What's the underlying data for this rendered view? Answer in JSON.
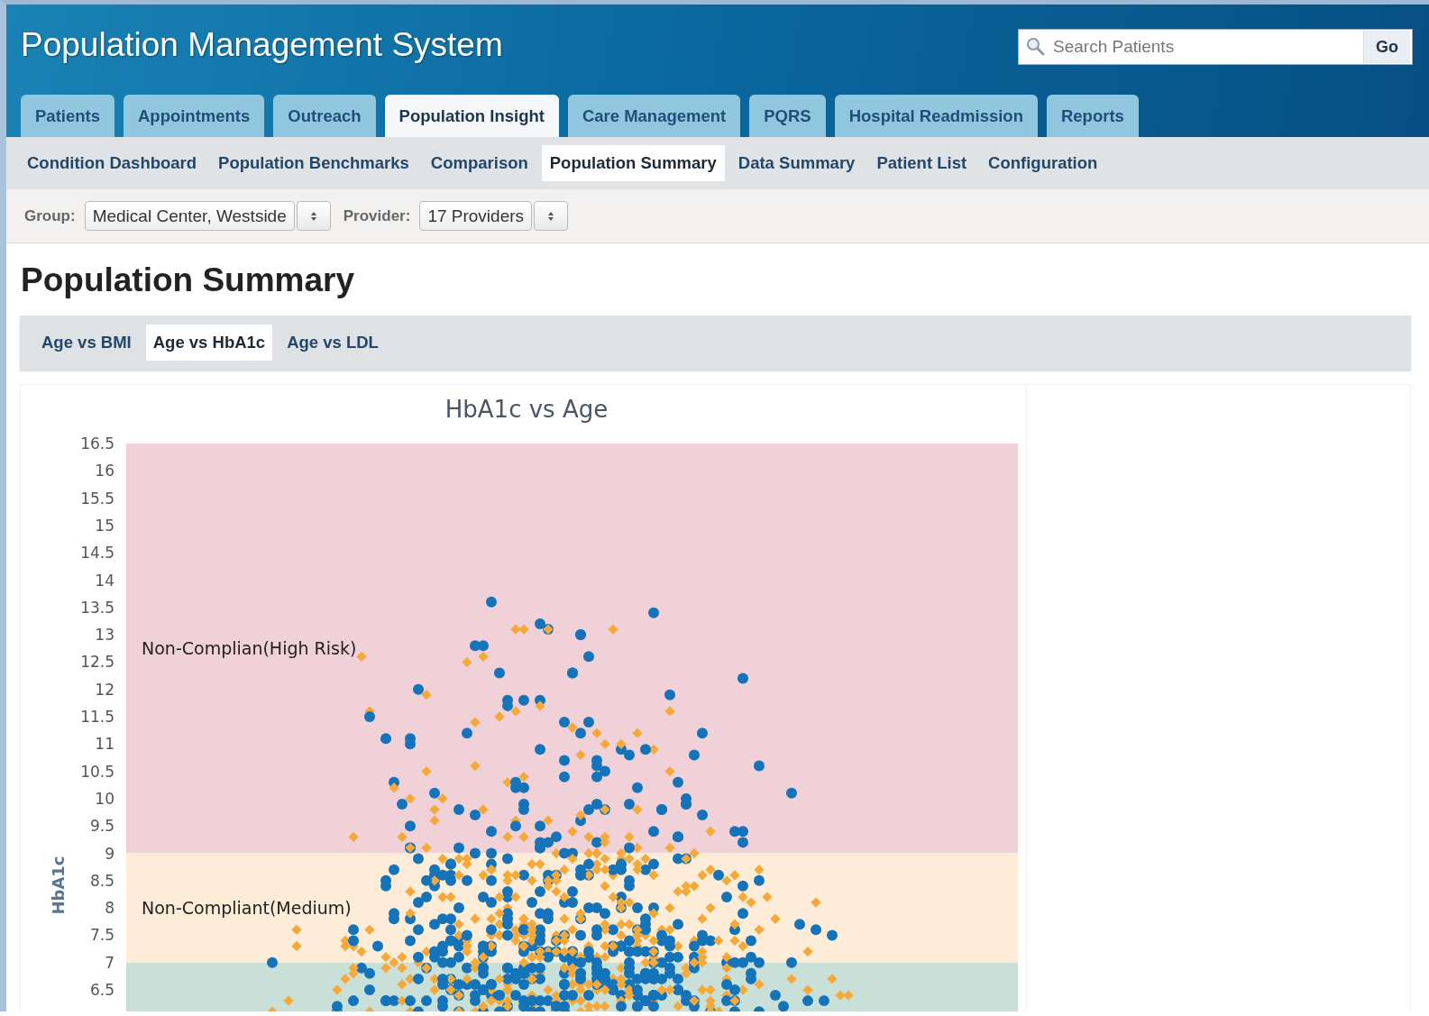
{
  "app": {
    "title": "Population Management System"
  },
  "search": {
    "placeholder": "Search Patients",
    "button": "Go"
  },
  "tabs": [
    {
      "label": "Patients",
      "selected": false
    },
    {
      "label": "Appointments",
      "selected": false
    },
    {
      "label": "Outreach",
      "selected": false
    },
    {
      "label": "Population Insight",
      "selected": true
    },
    {
      "label": "Care Management",
      "selected": false
    },
    {
      "label": "PQRS",
      "selected": false
    },
    {
      "label": "Hospital Readmission",
      "selected": false
    },
    {
      "label": "Reports",
      "selected": false
    }
  ],
  "subnav": [
    {
      "label": "Condition Dashboard",
      "selected": false
    },
    {
      "label": "Population Benchmarks",
      "selected": false
    },
    {
      "label": "Comparison",
      "selected": false
    },
    {
      "label": "Population Summary",
      "selected": true
    },
    {
      "label": "Data Summary",
      "selected": false
    },
    {
      "label": "Patient List",
      "selected": false
    },
    {
      "label": "Configuration",
      "selected": false
    }
  ],
  "filters": [
    {
      "label": "Group:",
      "value": "Medical Center, Westside"
    },
    {
      "label": "Provider:",
      "value": "17 Providers"
    }
  ],
  "heading": "Population Summary",
  "chart_tabs": [
    {
      "label": "Age vs BMI",
      "selected": false
    },
    {
      "label": "Age vs HbA1c",
      "selected": true
    },
    {
      "label": "Age vs LDL",
      "selected": false
    }
  ],
  "chart": {
    "title": "HbA1c vs Age",
    "ylabel": "HbA1c",
    "yticks": [
      "16.5",
      "16",
      "15.5",
      "15",
      "14.5",
      "14",
      "13.5",
      "13",
      "12.5",
      "12",
      "11.5",
      "11",
      "10.5",
      "10",
      "9.5",
      "9",
      "8.5",
      "8",
      "7.5",
      "7",
      "6.5"
    ],
    "bands": [
      {
        "label": "Non-Complian(High Risk)",
        "color": "#f0d1d8"
      },
      {
        "label": "Non-Compliant(Medium)",
        "color": "#fdecd8"
      },
      {
        "color": "#c9e0d8"
      }
    ]
  }
}
